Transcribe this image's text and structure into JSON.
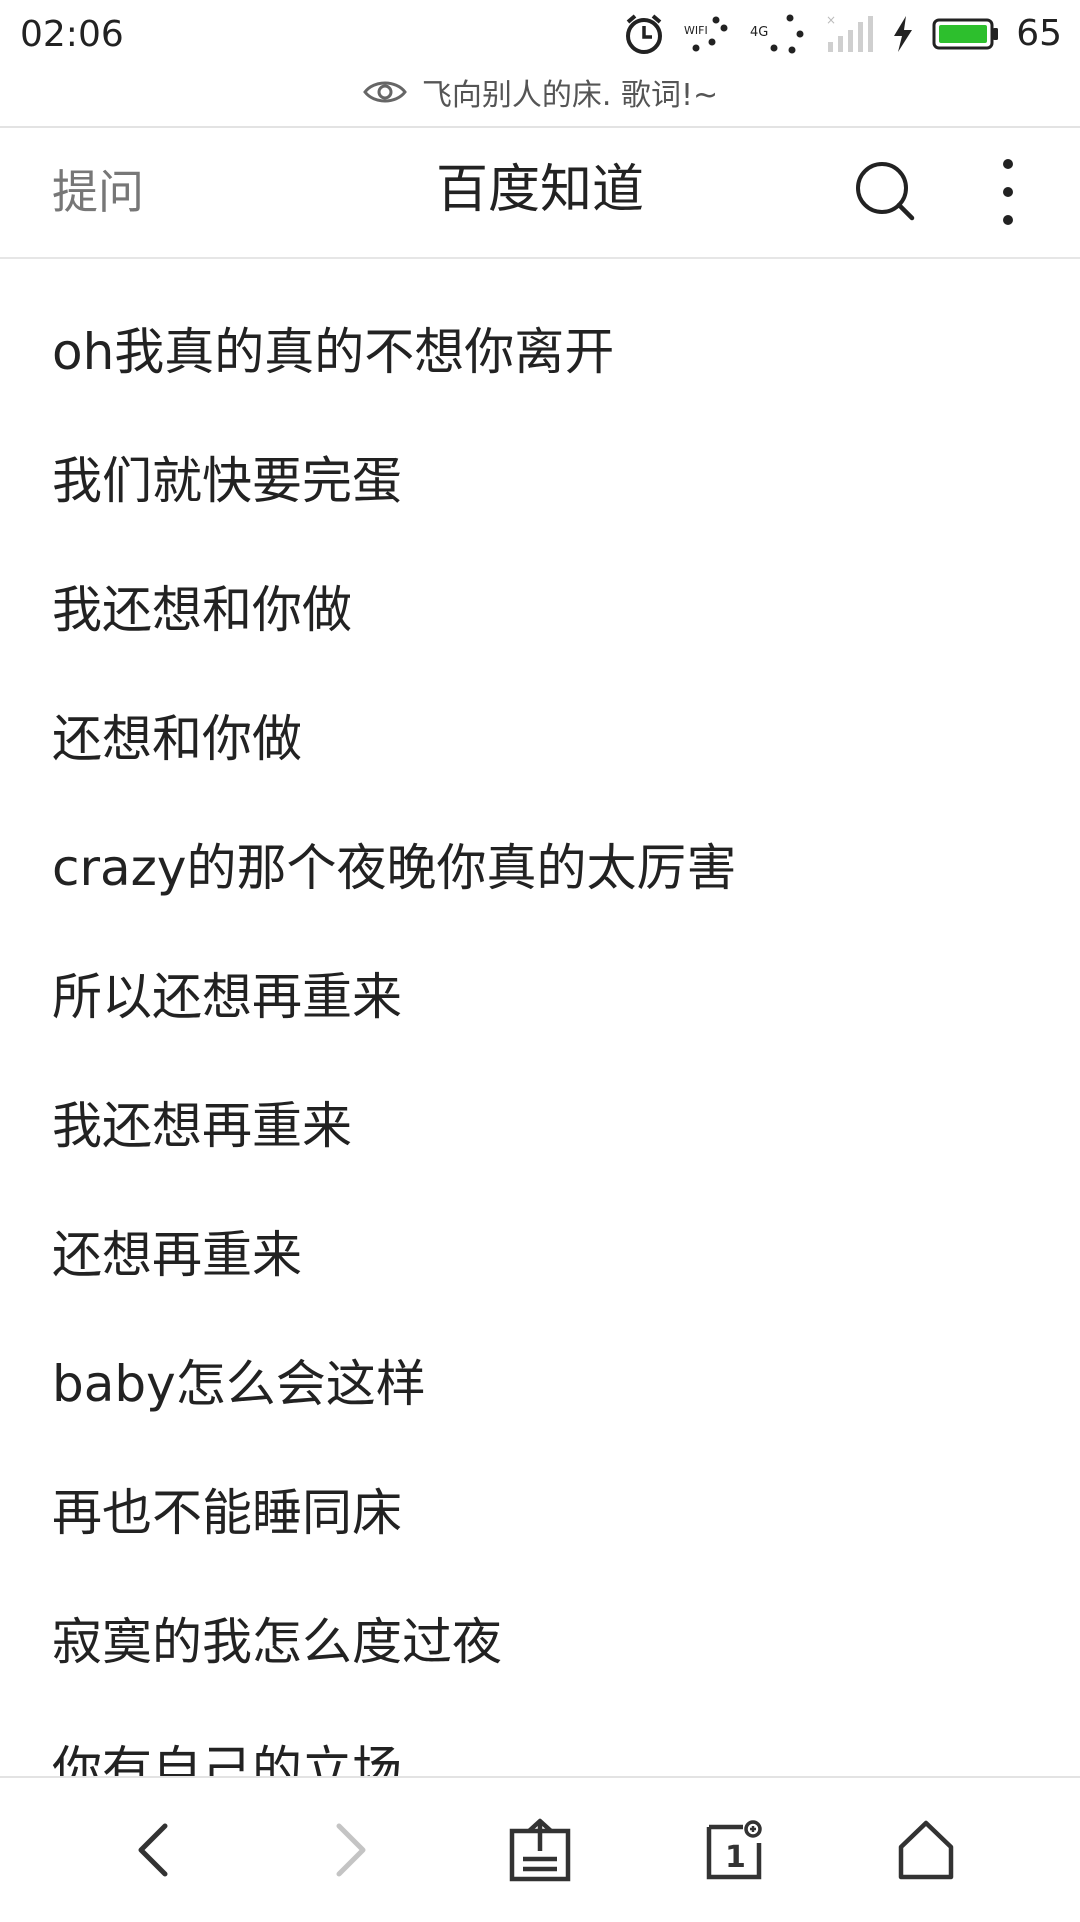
{
  "status_bar": {
    "time": "02:06",
    "battery_percent": "65",
    "wifi_label": "WIFI",
    "network_label": "4G",
    "battery_color": "#2dbf2d"
  },
  "page": {
    "subtitle": "飞向别人的床. 歌词!~"
  },
  "header": {
    "ask_label": "提问",
    "title": "百度知道"
  },
  "lyrics": [
    "oh我真的真的不想你离开",
    "我们就快要完蛋",
    "我还想和你做",
    "还想和你做",
    "crazy的那个夜晚你真的太厉害",
    "所以还想再重来",
    "我还想再重来",
    "还想再重来",
    "baby怎么会这样",
    "再也不能睡同床",
    "寂寞的我怎么度过夜",
    "你有自己的立场"
  ],
  "toolbar": {
    "tab_count": "1"
  }
}
